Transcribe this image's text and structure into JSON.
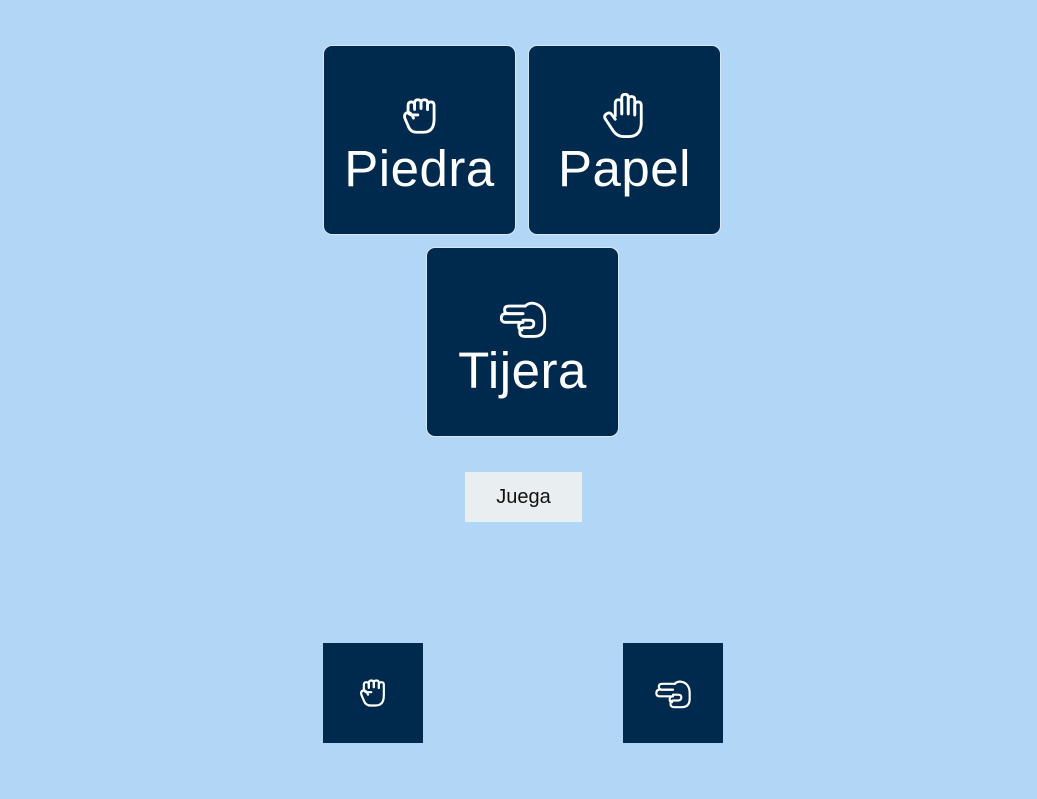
{
  "choices": [
    {
      "id": "piedra",
      "label": "Piedra",
      "icon": "hand-rock-icon"
    },
    {
      "id": "papel",
      "label": "Papel",
      "icon": "hand-paper-icon"
    },
    {
      "id": "tijera",
      "label": "Tijera",
      "icon": "hand-scissors-icon"
    }
  ],
  "play_button": {
    "label": "Juega"
  },
  "results": {
    "player": {
      "icon": "hand-rock-icon"
    },
    "computer": {
      "icon": "hand-scissors-icon"
    }
  },
  "colors": {
    "background": "#b2d6f5",
    "card": "#002a4d",
    "card_border": "#d9e7f3",
    "card_text": "#ffffff",
    "button_bg": "#e9eef0"
  }
}
